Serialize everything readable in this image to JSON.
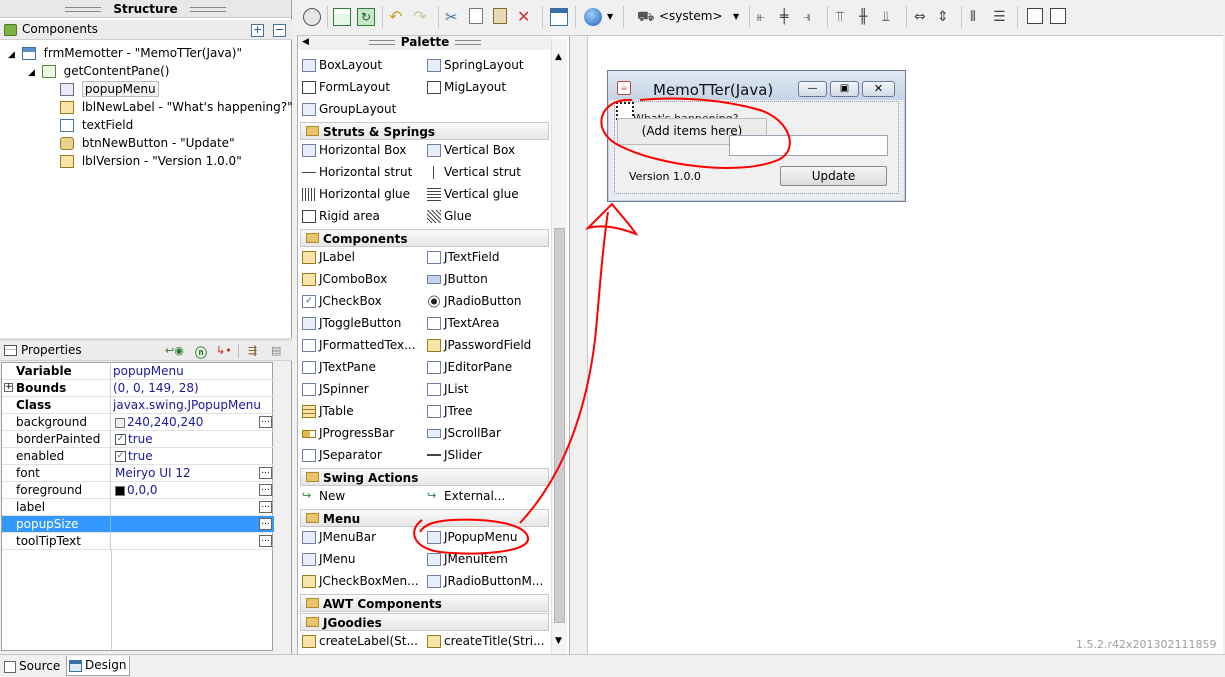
{
  "structure": {
    "title": "Structure",
    "components_label": "Components",
    "tree": [
      {
        "label": "frmMemotter - \"MemoTTer(Java)\"",
        "icon": "frame-icon"
      },
      {
        "label": "getContentPane()",
        "icon": "panel-icon"
      },
      {
        "label": "popupMenu",
        "icon": "popup-menu-icon"
      },
      {
        "label": "lblNewLabel - \"What's happening?\"",
        "icon": "label-icon"
      },
      {
        "label": "textField",
        "icon": "textfield-icon"
      },
      {
        "label": "btnNewButton - \"Update\"",
        "icon": "button-icon"
      },
      {
        "label": "lblVersion - \"Version 1.0.0\"",
        "icon": "label-icon"
      }
    ]
  },
  "properties": {
    "title": "Properties",
    "rows": [
      {
        "name": "Variable",
        "value": "popupMenu",
        "bold": true
      },
      {
        "name": "Bounds",
        "value": "(0, 0, 149, 28)",
        "bold": true
      },
      {
        "name": "Class",
        "value": "javax.swing.JPopupMenu",
        "bold": true
      },
      {
        "name": "background",
        "value": "240,240,240"
      },
      {
        "name": "borderPainted",
        "value": "true"
      },
      {
        "name": "enabled",
        "value": "true"
      },
      {
        "name": "font",
        "value": "Meiryo UI 12"
      },
      {
        "name": "foreground",
        "value": "0,0,0"
      },
      {
        "name": "label",
        "value": ""
      },
      {
        "name": "popupSize",
        "value": ""
      },
      {
        "name": "toolTipText",
        "value": ""
      }
    ]
  },
  "toolbar": {
    "lookandfeel": "<system>"
  },
  "palette": {
    "title": "Palette",
    "layouts": [
      "BoxLayout",
      "SpringLayout",
      "FormLayout",
      "MigLayout",
      "GroupLayout"
    ],
    "categories": {
      "struts": "Struts & Springs",
      "components": "Components",
      "swing_actions": "Swing Actions",
      "menu": "Menu",
      "awt": "AWT Components",
      "jgoodies": "JGoodies"
    },
    "struts_items": [
      "Horizontal Box",
      "Vertical Box",
      "Horizontal strut",
      "Vertical strut",
      "Horizontal glue",
      "Vertical glue",
      "Rigid area",
      "Glue"
    ],
    "component_items": [
      "JLabel",
      "JTextField",
      "JComboBox",
      "JButton",
      "JCheckBox",
      "JRadioButton",
      "JToggleButton",
      "JTextArea",
      "JFormattedTex...",
      "JPasswordField",
      "JTextPane",
      "JEditorPane",
      "JSpinner",
      "JList",
      "JTable",
      "JTree",
      "JProgressBar",
      "JScrollBar",
      "JSeparator",
      "JSlider"
    ],
    "action_items": [
      "New",
      "External..."
    ],
    "menu_items": [
      "JMenuBar",
      "JPopupMenu",
      "JMenu",
      "JMenuItem",
      "JCheckBoxMen...",
      "JRadioButtonM..."
    ],
    "jgoodies_items": [
      "createLabel(St...",
      "createTitle(Stri..."
    ]
  },
  "design": {
    "window_title": "MemoTTer(Java)",
    "label_text": "What's happening?",
    "popup_text": "(Add items here)",
    "version_text": "Version 1.0.0",
    "button_text": "Update",
    "build_version": "1.5.2.r42x201302111859"
  },
  "bottom_tabs": {
    "source": "Source",
    "design": "Design"
  },
  "colors": {
    "selection": "#3399ff",
    "annotation": "#ff0000",
    "value_text": "#1a1a9c"
  }
}
